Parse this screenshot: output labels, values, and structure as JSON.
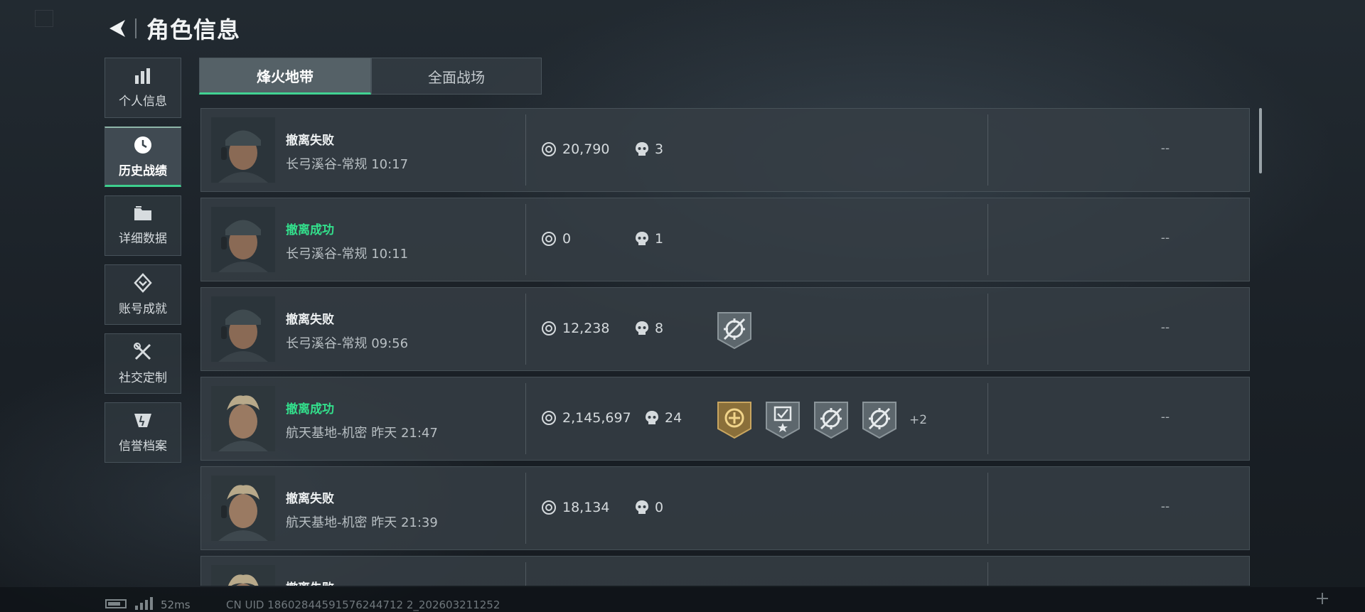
{
  "header": {
    "title": "角色信息"
  },
  "sidebar": {
    "items": [
      {
        "label": "个人信息",
        "icon": "bar-chart-icon"
      },
      {
        "label": "历史战绩",
        "icon": "clock-icon",
        "active": true
      },
      {
        "label": "详细数据",
        "icon": "folder-icon"
      },
      {
        "label": "账号成就",
        "icon": "diamond-achievement-icon"
      },
      {
        "label": "社交定制",
        "icon": "wrench-screwdriver-icon"
      },
      {
        "label": "信誉档案",
        "icon": "credit-emblem-icon"
      }
    ]
  },
  "tabs": [
    {
      "label": "烽火地带",
      "active": true
    },
    {
      "label": "全面战场",
      "active": false
    }
  ],
  "records": [
    {
      "result": "撤离失败",
      "success": false,
      "map": "长弓溪谷-常规 10:17",
      "value": "20,790",
      "kills": "3",
      "badges": [],
      "more": "",
      "placeholder": "--"
    },
    {
      "result": "撤离成功",
      "success": true,
      "map": "长弓溪谷-常规 10:11",
      "value": "0",
      "kills": "1",
      "badges": [],
      "more": "",
      "placeholder": "--"
    },
    {
      "result": "撤离失败",
      "success": false,
      "map": "长弓溪谷-常规 09:56",
      "value": "12,238",
      "kills": "8",
      "badges": [
        "crosshair-badge-icon"
      ],
      "more": "",
      "placeholder": "--"
    },
    {
      "result": "撤离成功",
      "success": true,
      "map": "航天基地-机密 昨天 21:47",
      "value": "2,145,697",
      "kills": "24",
      "badges": [
        "gold-emblem-badge-icon",
        "checklist-star-badge-icon",
        "crosshair-badge-icon",
        "crosshair-badge-icon"
      ],
      "more": "+2",
      "placeholder": "--"
    },
    {
      "result": "撤离失败",
      "success": false,
      "map": "航天基地-机密 昨天 21:39",
      "value": "18,134",
      "kills": "0",
      "badges": [],
      "more": "",
      "placeholder": "--"
    },
    {
      "result": "撤离失败",
      "success": false,
      "map": "",
      "value": "",
      "kills": "",
      "badges": [],
      "more": "",
      "placeholder": ""
    }
  ],
  "status": {
    "ping": "52ms",
    "uid": "CN UID 18602844591576244712 2_202603211252"
  },
  "colors": {
    "accent": "#3ecf8e",
    "success_text": "#33e08c",
    "background": "#1b2127"
  }
}
